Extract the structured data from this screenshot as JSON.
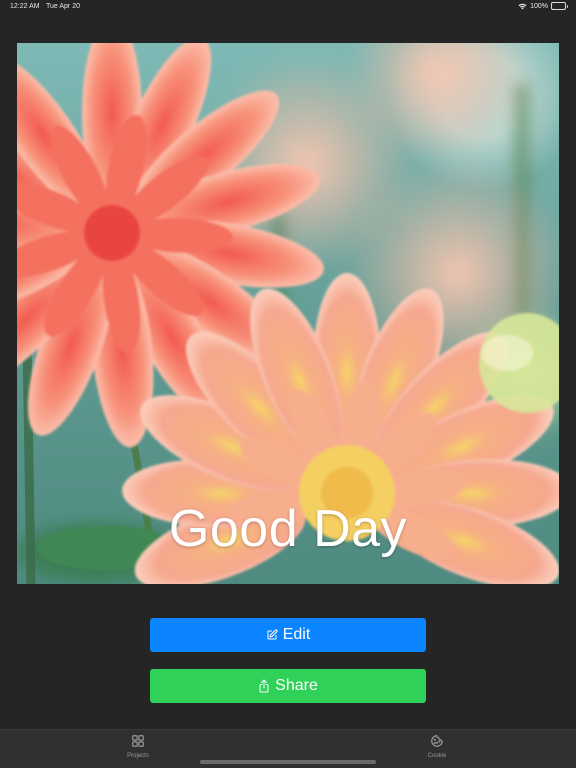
{
  "status_bar": {
    "time": "12:22 AM",
    "date": "Tue Apr 20",
    "battery": "100%",
    "icons": [
      "wifi-icon",
      "battery-icon"
    ]
  },
  "photo": {
    "caption": "Good Day",
    "subject": "dahlia-flowers"
  },
  "actions": {
    "edit_label": "Edit",
    "edit_icon": "pencil-square-icon",
    "share_label": "Share",
    "share_icon": "share-icon"
  },
  "tab_bar": {
    "items": [
      {
        "label": "Projects",
        "icon": "grid-icon"
      },
      {
        "label": "Cookie",
        "icon": "cookie-icon"
      }
    ]
  },
  "colors": {
    "background": "#252525",
    "edit_button": "#0a84ff",
    "share_button": "#30d158",
    "tab_bar": "#303030",
    "tab_inactive": "#9a9a9a"
  }
}
